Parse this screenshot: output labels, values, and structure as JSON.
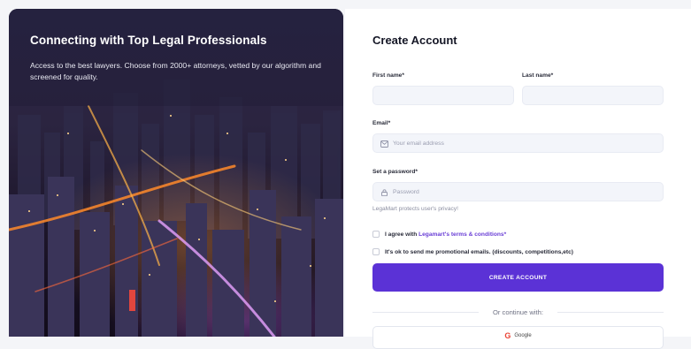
{
  "hero": {
    "title": "Connecting with Top Legal Professionals",
    "subtitle": "Access to the best lawyers. Choose from 2000+ attorneys, vetted by our algorithm and screened for quality."
  },
  "form": {
    "title": "Create Account",
    "first_name_label": "First name*",
    "last_name_label": "Last name*",
    "email_label": "Email*",
    "email_placeholder": "Your email address",
    "password_label": "Set a password*",
    "password_placeholder": "Password",
    "privacy_note": "LegaMart protects user's privacy!",
    "terms_prefix": "I agree with ",
    "terms_link": "Legamart's terms & conditions",
    "terms_required": "*",
    "promo_label": "It's ok to send me promotional emails. (discounts, competitions,etc)",
    "submit_label": "CREATE ACCOUNT",
    "divider_text": "Or continue with:",
    "google_label": "Google"
  },
  "colors": {
    "accent": "#5b32d6",
    "link": "#6a3fd6"
  },
  "icons": {
    "email": "envelope-icon",
    "password": "lock-icon",
    "google": "google-icon"
  }
}
